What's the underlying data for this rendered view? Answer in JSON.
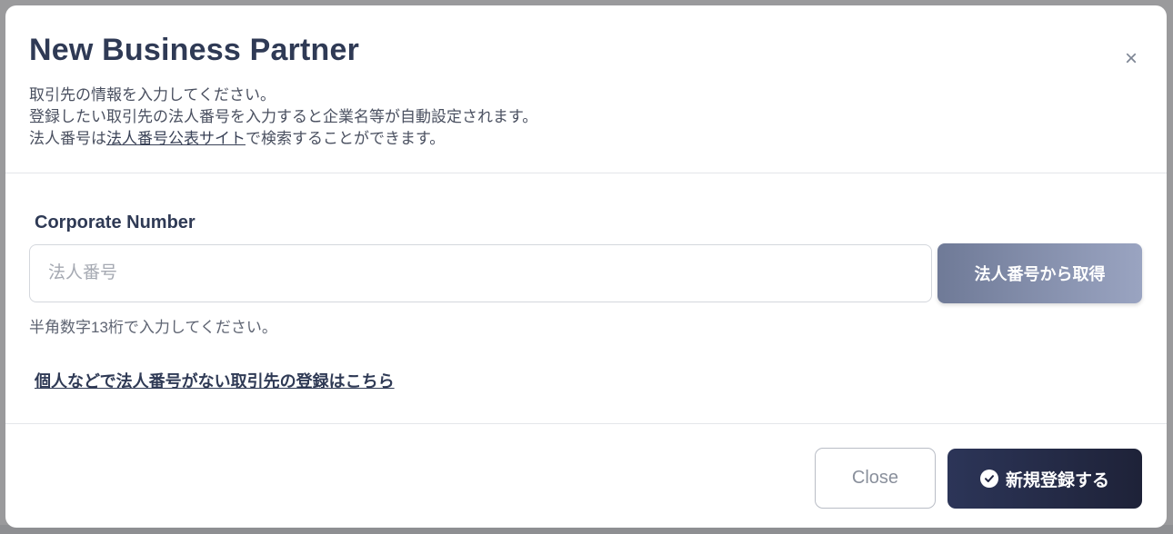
{
  "modal": {
    "title": "New Business Partner",
    "close_icon": "×",
    "description": {
      "line1": "取引先の情報を入力してください。",
      "line2": "登録したい取引先の法人番号を入力すると企業名等が自動設定されます。",
      "line3_prefix": "法人番号は",
      "line3_link": "法人番号公表サイト",
      "line3_suffix": "で検索することができます。"
    }
  },
  "form": {
    "label": "Corporate Number",
    "input_placeholder": "法人番号",
    "input_value": "",
    "fetch_button": "法人番号から取得",
    "hint": "半角数字13桁で入力してください。",
    "no_corp_link": "個人などで法人番号がない取引先の登録はこちら"
  },
  "footer": {
    "close_button": "Close",
    "register_button": "新規登録する",
    "register_icon": "check-circle-icon"
  },
  "colors": {
    "primary": "#2c3558",
    "secondary_button": "#7d88a6",
    "title": "#2f3a55"
  }
}
